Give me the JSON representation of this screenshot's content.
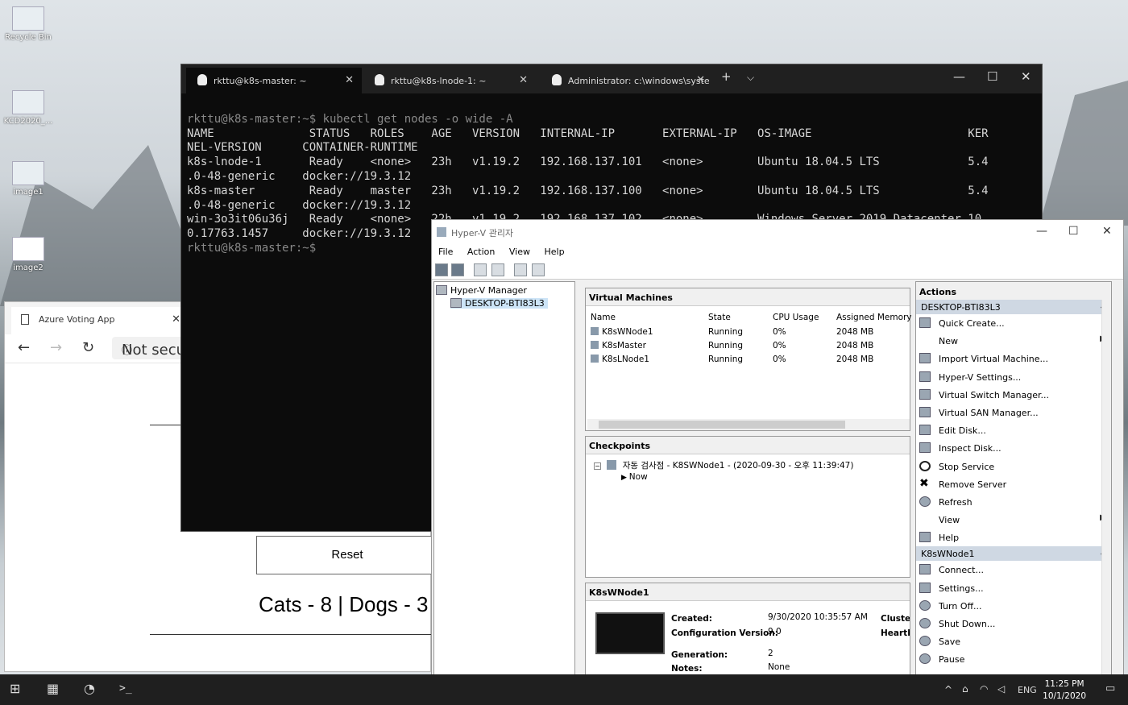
{
  "desktop": {
    "icons": [
      {
        "label": "Recycle Bin"
      },
      {
        "label": "KCD2020_..."
      },
      {
        "label": "image1"
      },
      {
        "label": "image2"
      }
    ]
  },
  "browser": {
    "tab_title": "Azure Voting App",
    "address": "Not secu",
    "reset_label": "Reset",
    "result_text": "Cats - 8 | Dogs - 3"
  },
  "terminal": {
    "tabs": [
      {
        "label": "rkttu@k8s-master: ~"
      },
      {
        "label": "rkttu@k8s-lnode-1: ~"
      },
      {
        "label": "Administrator: c:\\windows\\syste"
      }
    ],
    "lines": [
      "rkttu@k8s-master:~$ kubectl get nodes -o wide -A",
      "NAME              STATUS   ROLES    AGE   VERSION   INTERNAL-IP       EXTERNAL-IP   OS-IMAGE                       KER",
      "NEL-VERSION      CONTAINER-RUNTIME",
      "k8s-lnode-1       Ready    <none>   23h   v1.19.2   192.168.137.101   <none>        Ubuntu 18.04.5 LTS             5.4",
      ".0-48-generic    docker://19.3.12",
      "k8s-master        Ready    master   23h   v1.19.2   192.168.137.100   <none>        Ubuntu 18.04.5 LTS             5.4",
      ".0-48-generic    docker://19.3.12",
      "win-3o3it06u36j   Ready    <none>   22h   v1.19.2   192.168.137.102   <none>        Windows Server 2019 Datacenter 10.",
      "0.17763.1457     docker://19.3.12",
      "rkttu@k8s-master:~$"
    ]
  },
  "hyperv": {
    "title": "Hyper-V 관리자",
    "menu": [
      "File",
      "Action",
      "View",
      "Help"
    ],
    "tree": {
      "root": "Hyper-V Manager",
      "host": "DESKTOP-BTI83L3"
    },
    "vm_panel": {
      "title": "Virtual Machines",
      "columns": [
        "Name",
        "State",
        "CPU Usage",
        "Assigned Memory"
      ],
      "rows": [
        {
          "name": "K8sWNode1",
          "state": "Running",
          "cpu": "0%",
          "mem": "2048 MB"
        },
        {
          "name": "K8sMaster",
          "state": "Running",
          "cpu": "0%",
          "mem": "2048 MB"
        },
        {
          "name": "K8sLNode1",
          "state": "Running",
          "cpu": "0%",
          "mem": "2048 MB"
        }
      ]
    },
    "checkpoints": {
      "title": "Checkpoints",
      "item": "자동 검사점 - K8SWNode1 - (2020-09-30 - 오후 11:39:47)",
      "now": "Now"
    },
    "details": {
      "title": "K8sWNode1",
      "created_label": "Created:",
      "created_value": "9/30/2020 10:35:57 AM",
      "config_label": "Configuration Version:",
      "config_value": "9.0",
      "generation_label": "Generation:",
      "generation_value": "2",
      "notes_label": "Notes:",
      "notes_value": "None",
      "clustered_label": "Clustere",
      "heartbeat_label": "Heartbe"
    },
    "actions": {
      "title": "Actions",
      "group1": "DESKTOP-BTI83L3",
      "group1_items": [
        "Quick Create...",
        "New",
        "Import Virtual Machine...",
        "Hyper-V Settings...",
        "Virtual Switch Manager...",
        "Virtual SAN Manager...",
        "Edit Disk...",
        "Inspect Disk...",
        "Stop Service",
        "Remove Server",
        "Refresh",
        "View",
        "Help"
      ],
      "group2": "K8sWNode1",
      "group2_items": [
        "Connect...",
        "Settings...",
        "Turn Off...",
        "Shut Down...",
        "Save",
        "Pause"
      ]
    }
  },
  "taskbar": {
    "lang": "ENG",
    "time": "11:25 PM",
    "date": "10/1/2020"
  }
}
